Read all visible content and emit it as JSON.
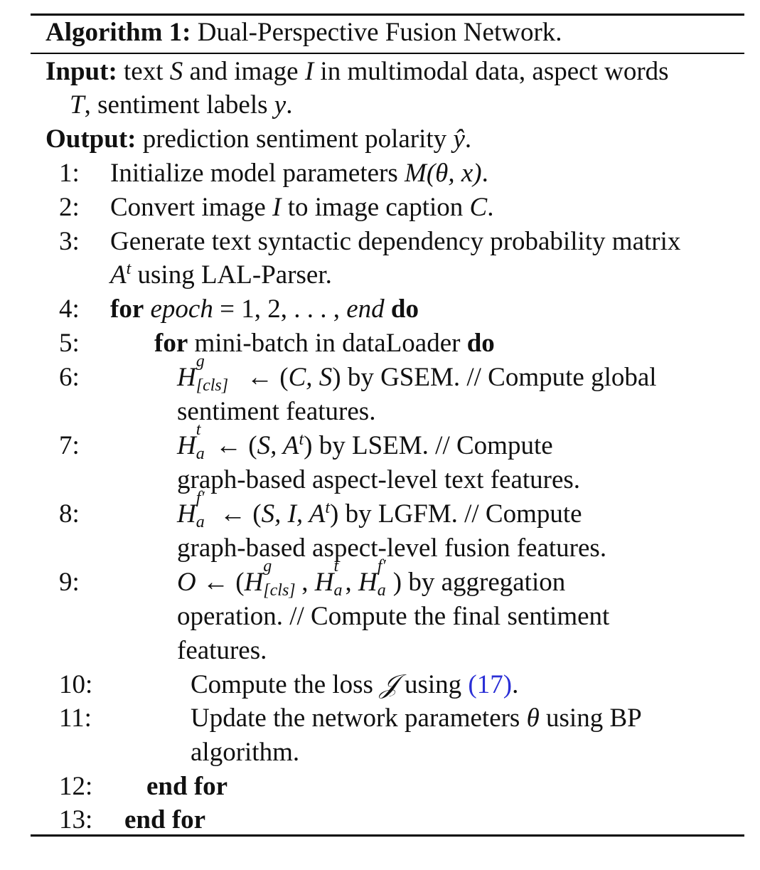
{
  "algorithm": {
    "caption_label": "Algorithm 1:",
    "caption_title": "Dual-Perspective Fusion Network.",
    "input_label": "Input:",
    "input_text_1": "text",
    "input_var_S": "S",
    "input_text_2": "and image",
    "input_var_I": "I",
    "input_text_3": "in multimodal data, aspect words",
    "input_var_T": "T",
    "input_text_4": ", sentiment labels",
    "input_var_y": "y",
    "input_text_5": ".",
    "output_label": "Output:",
    "output_text": "prediction sentiment polarity",
    "output_var": "ŷ",
    "output_end": ".",
    "steps": [
      {
        "num": "1:",
        "text": "Initialize model parameters",
        "math": "M(θ, x)",
        "end": "."
      },
      {
        "num": "2:",
        "text_a": "Convert image",
        "var_a": "I",
        "text_b": "to image caption",
        "var_b": "C",
        "end": "."
      },
      {
        "num": "3:",
        "text_a": "Generate text syntactic dependency probability matrix",
        "var_a": "A",
        "sup_a": "t",
        "text_b": "using LAL-Parser."
      },
      {
        "num": "4:",
        "kw": "for",
        "var": "epoch",
        "eq": " = 1, 2, . . . ,",
        "var2": "end",
        "kw2": "do"
      },
      {
        "num": "5:",
        "kw": "for",
        "text": "mini-batch in dataLoader",
        "kw2": "do"
      },
      {
        "num": "6:",
        "var": "H",
        "sup": "g",
        "sub": "[cls]",
        "arrow": " ← (",
        "m1": "C, S",
        "close": ")",
        "text": "by GSEM. // Compute global",
        "text_b": "sentiment features."
      },
      {
        "num": "7:",
        "var": "H",
        "sup": "t",
        "sub": "a",
        "arrow": " ← (",
        "m1": "S, A",
        "m1sup": "t",
        "close": ")",
        "text": "by LSEM. // Compute",
        "text_b": "graph-based aspect-level text features."
      },
      {
        "num": "8:",
        "var": "H",
        "sup": "f′",
        "sub": "a",
        "arrow": " ← (",
        "m1": "S, I, A",
        "m1sup": "t",
        "close": ")",
        "text": "by LGFM. // Compute",
        "text_b": "graph-based aspect-level fusion features."
      },
      {
        "num": "9:",
        "var": "O",
        "arrow": " ← (",
        "t1": "H",
        "t1sup": "g",
        "t1sub": "[cls]",
        "t2": "H",
        "t2sup": "t",
        "t2sub": "a",
        "t3": "H",
        "t3sup": "f′",
        "t3sub": "a",
        "close": ")",
        "text": "by aggregation",
        "text_b": "operation. // Compute the final sentiment",
        "text_c": "features."
      },
      {
        "num": "10:",
        "text": "Compute the loss",
        "var": "𝒥",
        "text_b": "using",
        "ref": "(17)",
        "end": "."
      },
      {
        "num": "11:",
        "text": "Update the network parameters",
        "var": "θ",
        "text_b": "using BP",
        "text_c": "algorithm."
      },
      {
        "num": "12:",
        "kw": "end for"
      },
      {
        "num": "13:",
        "kw": "end for"
      }
    ]
  }
}
